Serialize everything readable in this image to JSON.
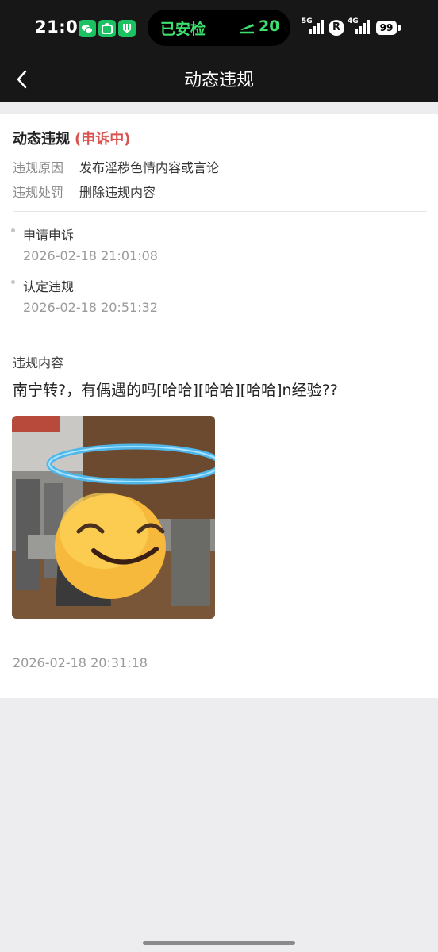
{
  "status_bar": {
    "time": "21:01",
    "pill_text": "已安检",
    "pill_number": "20",
    "net_5g": "5G",
    "net_4g": "4G",
    "roaming": "R",
    "battery": "99",
    "accent_color": "#3ee06d"
  },
  "header": {
    "title": "动态违规",
    "back_icon": "chevron-left-icon"
  },
  "violation": {
    "title": "动态违规",
    "status": "(申诉中)",
    "status_color": "#d9534f",
    "reason_label": "违规原因",
    "reason_value": "发布淫秽色情内容或言论",
    "penalty_label": "违规处罚",
    "penalty_value": "删除违规内容"
  },
  "timeline": [
    {
      "title": "申请申诉",
      "time": "2026-02-18 21:01:08"
    },
    {
      "title": "认定违规",
      "time": "2026-02-18 20:51:32"
    }
  ],
  "content": {
    "label": "违规内容",
    "text": "南宁转?，有偶遇的吗[哈哈][哈哈][哈哈]n经验??",
    "image": "smiling-face-with-halo-emoji-photo",
    "posted_time": "2026-02-18 20:31:18"
  }
}
